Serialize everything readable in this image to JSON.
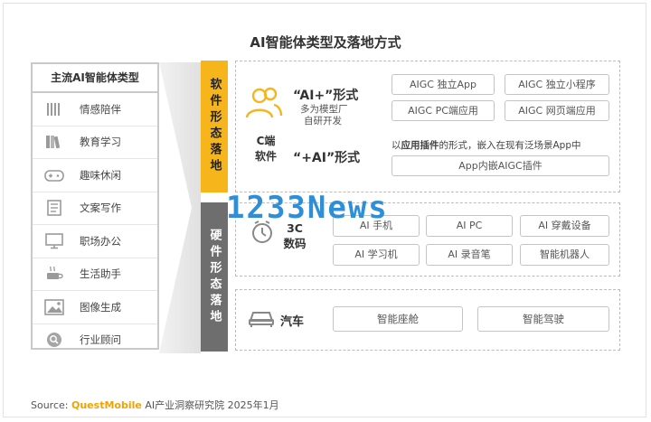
{
  "title": "AI智能体类型及落地方式",
  "categories": {
    "header": "主流AI智能体类型",
    "items": [
      {
        "label": "情感陪伴",
        "icon": "lines-icon"
      },
      {
        "label": "教育学习",
        "icon": "books-icon"
      },
      {
        "label": "趣味休闲",
        "icon": "gamepad-icon"
      },
      {
        "label": "文案写作",
        "icon": "document-icon"
      },
      {
        "label": "职场办公",
        "icon": "monitor-icon"
      },
      {
        "label": "生活助手",
        "icon": "coffee-icon"
      },
      {
        "label": "图像生成",
        "icon": "image-icon"
      },
      {
        "label": "行业顾问",
        "icon": "search-icon"
      }
    ]
  },
  "software": {
    "bar_label": "软件形态落地",
    "device_label_line1": "C端",
    "device_label_line2": "软件",
    "ai_plus_label": "“AI+”形式",
    "ai_plus_sub1": "多为模型厂",
    "ai_plus_sub2": "自研开发",
    "plus_ai_label": "“+AI”形式",
    "pills": [
      "AIGC 独立App",
      "AIGC 独立小程序",
      "AIGC PC端应用",
      "AIGC 网页端应用"
    ],
    "plugin_note_prefix": "以",
    "plugin_note_bold": "应用插件",
    "plugin_note_suffix": "的形式，嵌入在现有泛场景App中",
    "plugin_pill": "App内嵌AIGC插件"
  },
  "hardware": {
    "bar_label": "硬件形态落地",
    "digital_label_line1": "3C",
    "digital_label_line2": "数码",
    "digital_pills": [
      "AI 手机",
      "AI PC",
      "AI 穿戴设备",
      "AI 学习机",
      "AI 录音笔",
      "智能机器人"
    ],
    "car_label": "汽车",
    "car_pills": [
      "智能座舱",
      "智能驾驶"
    ]
  },
  "watermark": "1233News",
  "source": {
    "prefix": "Source:",
    "brand": "QuestMobile",
    "suffix": "AI产业洞察研究院 2025年1月"
  },
  "colors": {
    "software_accent": "#f5b51b",
    "hardware_accent": "#6e6e6e",
    "watermark": "#2e8fd8",
    "brand": "#f0a300"
  }
}
